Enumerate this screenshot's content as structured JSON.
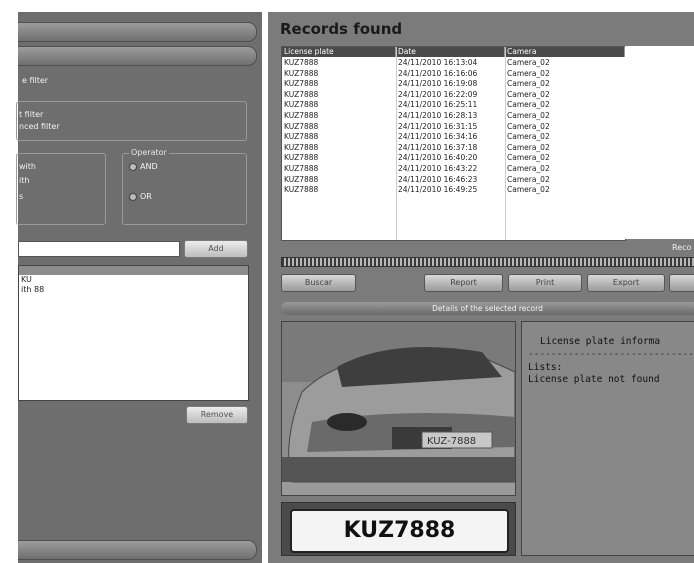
{
  "left": {
    "filter_mode_label": "e filter",
    "filter_options": [
      "t filter",
      "nced filter"
    ],
    "condition_options": [
      "with",
      "ith",
      "s"
    ],
    "operator": {
      "legend": "Operator",
      "options": [
        "AND",
        "OR"
      ]
    },
    "add_label": "Add",
    "filter_list": [
      "KU",
      "ith 88"
    ],
    "remove_label": "Remove"
  },
  "records": {
    "title": "Records found",
    "columns": [
      "License plate",
      "Date",
      "Camera"
    ],
    "rows": [
      [
        "KUZ7888",
        "24/11/2010 16:13:04",
        "Camera_02"
      ],
      [
        "KUZ7888",
        "24/11/2010 16:16:06",
        "Camera_02"
      ],
      [
        "KUZ7888",
        "24/11/2010 16:19:08",
        "Camera_02"
      ],
      [
        "KUZ7888",
        "24/11/2010 16:22:09",
        "Camera_02"
      ],
      [
        "KUZ7888",
        "24/11/2010 16:25:11",
        "Camera_02"
      ],
      [
        "KUZ7888",
        "24/11/2010 16:28:13",
        "Camera_02"
      ],
      [
        "KUZ7888",
        "24/11/2010 16:31:15",
        "Camera_02"
      ],
      [
        "KUZ7888",
        "24/11/2010 16:34:16",
        "Camera_02"
      ],
      [
        "KUZ7888",
        "24/11/2010 16:37:18",
        "Camera_02"
      ],
      [
        "KUZ7888",
        "24/11/2010 16:40:20",
        "Camera_02"
      ],
      [
        "KUZ7888",
        "24/11/2010 16:43:22",
        "Camera_02"
      ],
      [
        "KUZ7888",
        "24/11/2010 16:46:23",
        "Camera_02"
      ],
      [
        "KUZ7888",
        "24/11/2010 16:49:25",
        "Camera_02"
      ]
    ],
    "records_label": "Reco"
  },
  "toolbar": {
    "search": "Buscar",
    "report": "Report",
    "print": "Print",
    "export": "Export"
  },
  "details": {
    "title": "Details of the selected record",
    "photo_plate_text": "KUZ-7888",
    "plate": "KUZ7888",
    "info_title": "License plate informa",
    "info_sep": "--------------------------------",
    "lists_label": "Lists:",
    "lists_value": "License plate not found"
  }
}
